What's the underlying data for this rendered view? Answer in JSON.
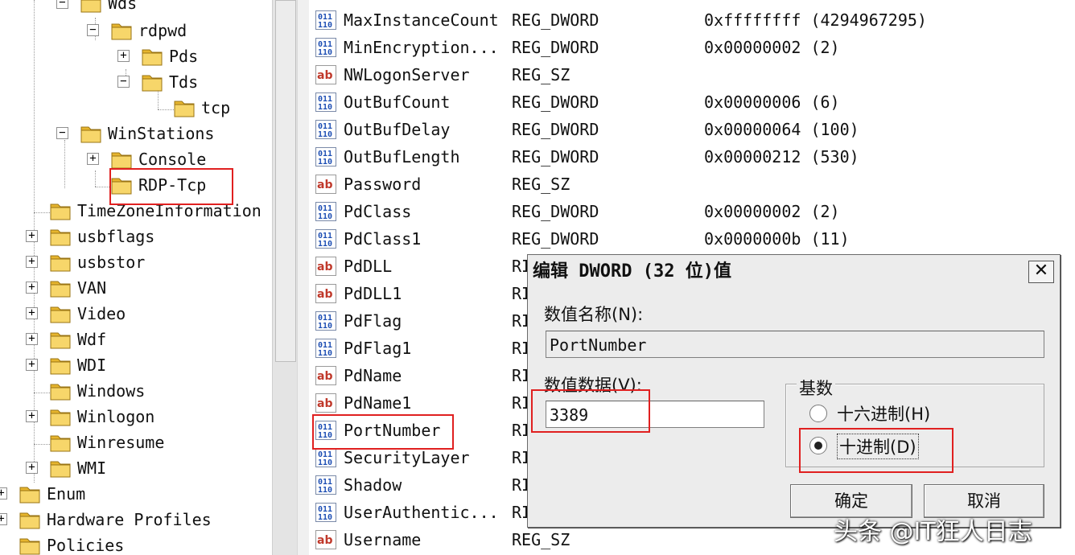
{
  "tree": {
    "nodes": [
      {
        "label": "Wds",
        "expander": "⊟"
      },
      {
        "label": "rdpwd",
        "expander": "⊟"
      },
      {
        "label": "Pds",
        "expander": "⊞"
      },
      {
        "label": "Tds",
        "expander": "⊟"
      },
      {
        "label": "tcp",
        "expander": ""
      },
      {
        "label": "WinStations",
        "expander": "⊟"
      },
      {
        "label": "Console",
        "expander": "⊞"
      },
      {
        "label": "RDP-Tcp",
        "expander": ""
      },
      {
        "label": "TimeZoneInformation",
        "expander": ""
      },
      {
        "label": "usbflags",
        "expander": "⊞"
      },
      {
        "label": "usbstor",
        "expander": "⊞"
      },
      {
        "label": "VAN",
        "expander": "⊞"
      },
      {
        "label": "Video",
        "expander": "⊞"
      },
      {
        "label": "Wdf",
        "expander": "⊞"
      },
      {
        "label": "WDI",
        "expander": "⊞"
      },
      {
        "label": "Windows",
        "expander": ""
      },
      {
        "label": "Winlogon",
        "expander": "⊞"
      },
      {
        "label": "Winresume",
        "expander": ""
      },
      {
        "label": "WMI",
        "expander": "⊞"
      },
      {
        "label": "Enum",
        "expander": "⊞"
      },
      {
        "label": "Hardware Profiles",
        "expander": "⊞"
      },
      {
        "label": "Policies",
        "expander": ""
      }
    ]
  },
  "values": [
    {
      "name": "MaxInstanceCount",
      "type": "REG_DWORD",
      "data": "0xffffffff (4294967295)",
      "icon": "dword-icon"
    },
    {
      "name": "MinEncryption...",
      "type": "REG_DWORD",
      "data": "0x00000002 (2)",
      "icon": "dword-icon"
    },
    {
      "name": "NWLogonServer",
      "type": "REG_SZ",
      "data": "",
      "icon": "string-icon"
    },
    {
      "name": "OutBufCount",
      "type": "REG_DWORD",
      "data": "0x00000006 (6)",
      "icon": "dword-icon"
    },
    {
      "name": "OutBufDelay",
      "type": "REG_DWORD",
      "data": "0x00000064 (100)",
      "icon": "dword-icon"
    },
    {
      "name": "OutBufLength",
      "type": "REG_DWORD",
      "data": "0x00000212 (530)",
      "icon": "dword-icon"
    },
    {
      "name": "Password",
      "type": "REG_SZ",
      "data": "",
      "icon": "string-icon"
    },
    {
      "name": "PdClass",
      "type": "REG_DWORD",
      "data": "0x00000002 (2)",
      "icon": "dword-icon"
    },
    {
      "name": "PdClass1",
      "type": "REG_DWORD",
      "data": "0x0000000b (11)",
      "icon": "dword-icon"
    },
    {
      "name": "PdDLL",
      "type": "RI",
      "data": "",
      "icon": "string-icon"
    },
    {
      "name": "PdDLL1",
      "type": "RI",
      "data": "",
      "icon": "string-icon"
    },
    {
      "name": "PdFlag",
      "type": "RI",
      "data": "",
      "icon": "dword-icon"
    },
    {
      "name": "PdFlag1",
      "type": "RI",
      "data": "",
      "icon": "dword-icon"
    },
    {
      "name": "PdName",
      "type": "RI",
      "data": "",
      "icon": "string-icon"
    },
    {
      "name": "PdName1",
      "type": "RI",
      "data": "",
      "icon": "string-icon"
    },
    {
      "name": "PortNumber",
      "type": "RI",
      "data": "",
      "icon": "dword-icon"
    },
    {
      "name": "SecurityLayer",
      "type": "RI",
      "data": "",
      "icon": "dword-icon"
    },
    {
      "name": "Shadow",
      "type": "RI",
      "data": "",
      "icon": "dword-icon"
    },
    {
      "name": "UserAuthentic...",
      "type": "RI",
      "data": "",
      "icon": "dword-icon"
    },
    {
      "name": "Username",
      "type": "REG_SZ",
      "data": "",
      "icon": "string-icon"
    }
  ],
  "dialog": {
    "title": "编辑 DWORD (32 位)值",
    "close_label": "✕",
    "name_label": "数值名称(N):",
    "name_value": "PortNumber",
    "data_label": "数值数据(V):",
    "data_value": "3389",
    "base_label": "基数",
    "hex_label": "十六进制(H)",
    "dec_label": "十进制(D)",
    "base_selected": "decimal",
    "ok_label": "确定",
    "cancel_label": "取消"
  },
  "watermark": "头条 @IT狂人日志",
  "colors": {
    "highlight": "#e02020",
    "folder": "#f2c94c",
    "dword_icon": "#1e4fb4",
    "string_icon": "#c0392b"
  }
}
